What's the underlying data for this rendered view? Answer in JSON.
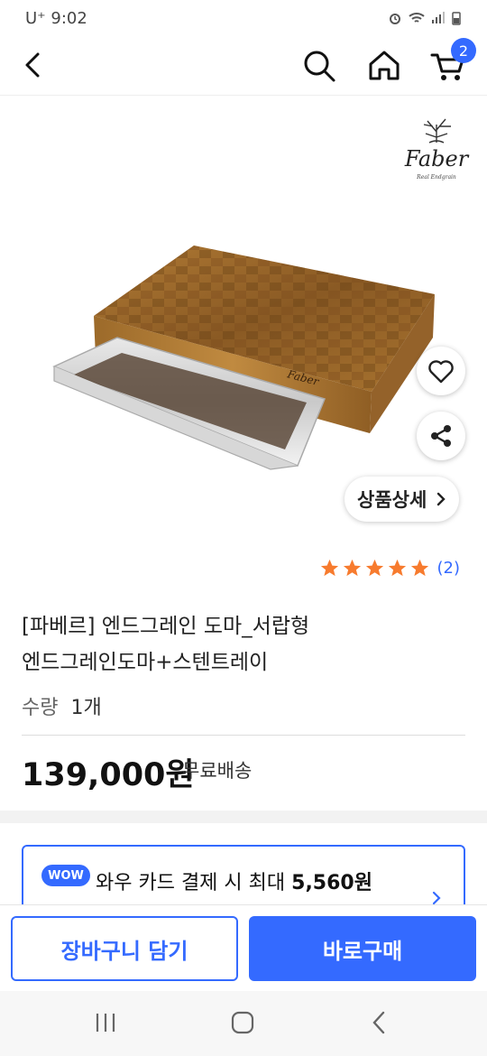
{
  "status_bar": {
    "carrier": "U⁺ 9:02"
  },
  "nav": {
    "cart_count": "2",
    "icons": [
      "back-icon",
      "search-icon",
      "home-icon",
      "cart-icon"
    ]
  },
  "product_image": {
    "brand_logo_text": "Faber",
    "detail_button_label": "상품상세",
    "detail_chevron": "›"
  },
  "rating": {
    "stars": 5,
    "review_count": "(2)",
    "star_color": "#f77b2e"
  },
  "product": {
    "title_line1": "[파베르] 엔드그레인 도마_서랍형",
    "title_line2": "엔드그레인도마+스텐트레이",
    "qty_label": "수량",
    "qty_value": "1개",
    "price": "139,000원",
    "shipping": "무료배송"
  },
  "wow": {
    "badge": "WOW",
    "text_prefix": "와우 카드 결제 시 최대 ",
    "amount": "5,560원"
  },
  "bottom_bar": {
    "cart_button": "장바구니 담기",
    "buy_button": "바로구매"
  },
  "colors": {
    "accent": "#346aff"
  }
}
